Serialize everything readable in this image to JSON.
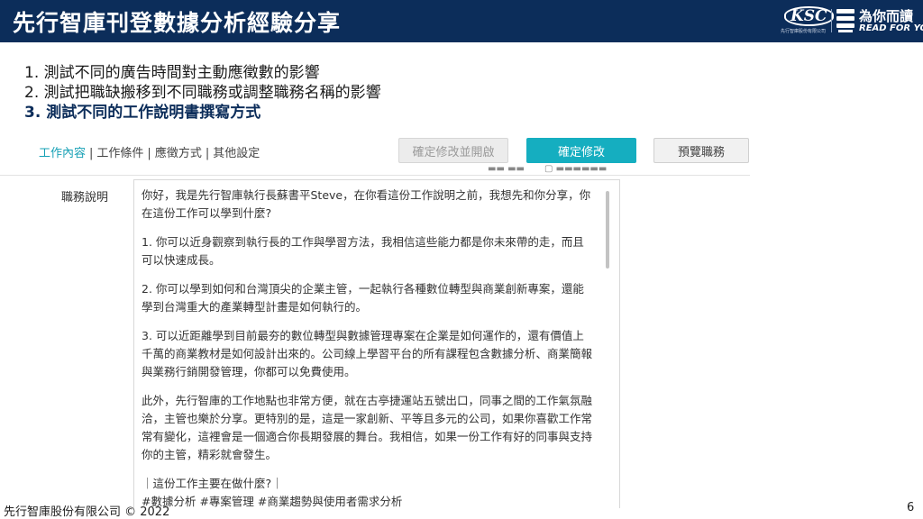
{
  "header": {
    "title": "先行智庫刊登數據分析經驗分享",
    "brand_ksc": {
      "logo": "KSC",
      "sub": "先行智庫股份有限公司"
    },
    "brand_rfy": {
      "cn": "為你而讀",
      "en": "READ FOR YOU",
      "icon": "book-icon"
    }
  },
  "points": [
    {
      "text": "1. 測試不同的廣告時間對主動應徵數的影響",
      "active": false
    },
    {
      "text": "2. 測試把職缺搬移到不同職務或調整職務名稱的影響",
      "active": false
    },
    {
      "text": "3. 測試不同的工作說明書撰寫方式",
      "active": true
    }
  ],
  "editor": {
    "tabs": [
      "工作內容",
      "工作條件",
      "應徵方式",
      "其他設定"
    ],
    "tab_separator": "|",
    "buttons": {
      "confirm_and_open": "確定修改並開啟",
      "confirm": "確定修改",
      "preview": "預覽職務"
    },
    "field_label": "職務說明",
    "description": [
      "你好，我是先行智庫執行長蘇書平Steve，在你看這份工作說明之前，我想先和你分享，你在這份工作可以學到什麼?",
      "1. 你可以近身觀察到執行長的工作與學習方法，我相信這些能力都是你未來帶的走，而且可以快速成長。",
      "2. 你可以學到如何和台灣頂尖的企業主管，一起執行各種數位轉型與商業創新專案，還能學到台灣重大的產業轉型計畫是如何執行的。",
      "3. 可以近距離學到目前最夯的數位轉型與數據管理專案在企業是如何運作的，還有價值上千萬的商業教材是如何設計出來的。公司線上學習平台的所有課程包含數據分析、商業簡報與業務行銷開發管理，你都可以免費使用。",
      "此外，先行智庫的工作地點也非常方便，就在古亭捷運站五號出口，同事之間的工作氣氛融洽，主管也樂於分享。更特別的是，這是一家創新、平等且多元的公司，如果你喜歡工作常常有變化，這裡會是一個適合你長期發展的舞台。我相信，如果一份工作有好的同事與支持你的主管，精彩就會發生。",
      "｜這份工作主要在做什麼?｜\n#數據分析 #專案管理 #商業趨勢與使用者需求分析"
    ]
  },
  "footer": {
    "company": "先行智庫股份有限公司 © 2022",
    "page_number": "6"
  },
  "colors": {
    "header_bg": "#0c2d5a",
    "accent": "#15aec0",
    "active_point": "#0c2d5a"
  }
}
